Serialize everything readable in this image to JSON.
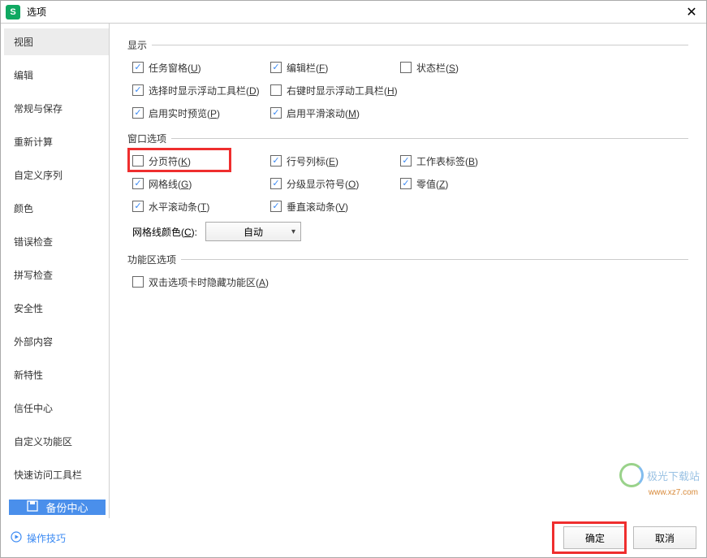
{
  "title": "选项",
  "title_icon_letter": "S",
  "sidebar": {
    "items": [
      {
        "label": "视图",
        "active": true
      },
      {
        "label": "编辑"
      },
      {
        "label": "常规与保存"
      },
      {
        "label": "重新计算"
      },
      {
        "label": "自定义序列"
      },
      {
        "label": "颜色"
      },
      {
        "label": "错误检查"
      },
      {
        "label": "拼写检查"
      },
      {
        "label": "安全性"
      },
      {
        "label": "外部内容"
      },
      {
        "label": "新特性"
      },
      {
        "label": "信任中心"
      },
      {
        "label": "自定义功能区"
      },
      {
        "label": "快速访问工具栏"
      }
    ],
    "backup_label": "备份中心"
  },
  "groups": {
    "display": {
      "title": "显示",
      "items": {
        "task_pane": {
          "label": "任务窗格(",
          "hotkey": "U",
          "suffix": ")",
          "checked": true
        },
        "formula_bar": {
          "label": "编辑栏(",
          "hotkey": "F",
          "suffix": ")",
          "checked": true
        },
        "status_bar": {
          "label": "状态栏(",
          "hotkey": "S",
          "suffix": ")",
          "checked": false
        },
        "sel_float": {
          "label": "选择时显示浮动工具栏(",
          "hotkey": "D",
          "suffix": ")",
          "checked": true
        },
        "rclick_float": {
          "label": "右键时显示浮动工具栏(",
          "hotkey": "H",
          "suffix": ")",
          "checked": false
        },
        "live_preview": {
          "label": "启用实时预览(",
          "hotkey": "P",
          "suffix": ")",
          "checked": true
        },
        "smooth_scroll": {
          "label": "启用平滑滚动(",
          "hotkey": "M",
          "suffix": ")",
          "checked": true
        }
      }
    },
    "window": {
      "title": "窗口选项",
      "items": {
        "page_break": {
          "label": "分页符(",
          "hotkey": "K",
          "suffix": ")",
          "checked": false
        },
        "row_col_hdr": {
          "label": "行号列标(",
          "hotkey": "E",
          "suffix": ")",
          "checked": true
        },
        "sheet_tabs": {
          "label": "工作表标签(",
          "hotkey": "B",
          "suffix": ")",
          "checked": true
        },
        "gridlines": {
          "label": "网格线(",
          "hotkey": "G",
          "suffix": ")",
          "checked": true
        },
        "outline": {
          "label": "分级显示符号(",
          "hotkey": "O",
          "suffix": ")",
          "checked": true
        },
        "zeros": {
          "label": "零值(",
          "hotkey": "Z",
          "suffix": ")",
          "checked": true
        },
        "hscroll": {
          "label": "水平滚动条(",
          "hotkey": "T",
          "suffix": ")",
          "checked": true
        },
        "vscroll": {
          "label": "垂直滚动条(",
          "hotkey": "V",
          "suffix": ")",
          "checked": true
        }
      },
      "grid_color_label": "网格线颜色(",
      "grid_color_hotkey": "C",
      "grid_color_suffix": "):",
      "grid_color_value": "自动"
    },
    "ribbon": {
      "title": "功能区选项",
      "items": {
        "dblclick_hide": {
          "label": "双击选项卡时隐藏功能区(",
          "hotkey": "A",
          "suffix": ")",
          "checked": false
        }
      }
    }
  },
  "footer": {
    "tips_label": "操作技巧",
    "ok_label": "确定",
    "cancel_label": "取消"
  },
  "watermark": {
    "text": "极光下载站",
    "sub": "www.xz7.com"
  }
}
